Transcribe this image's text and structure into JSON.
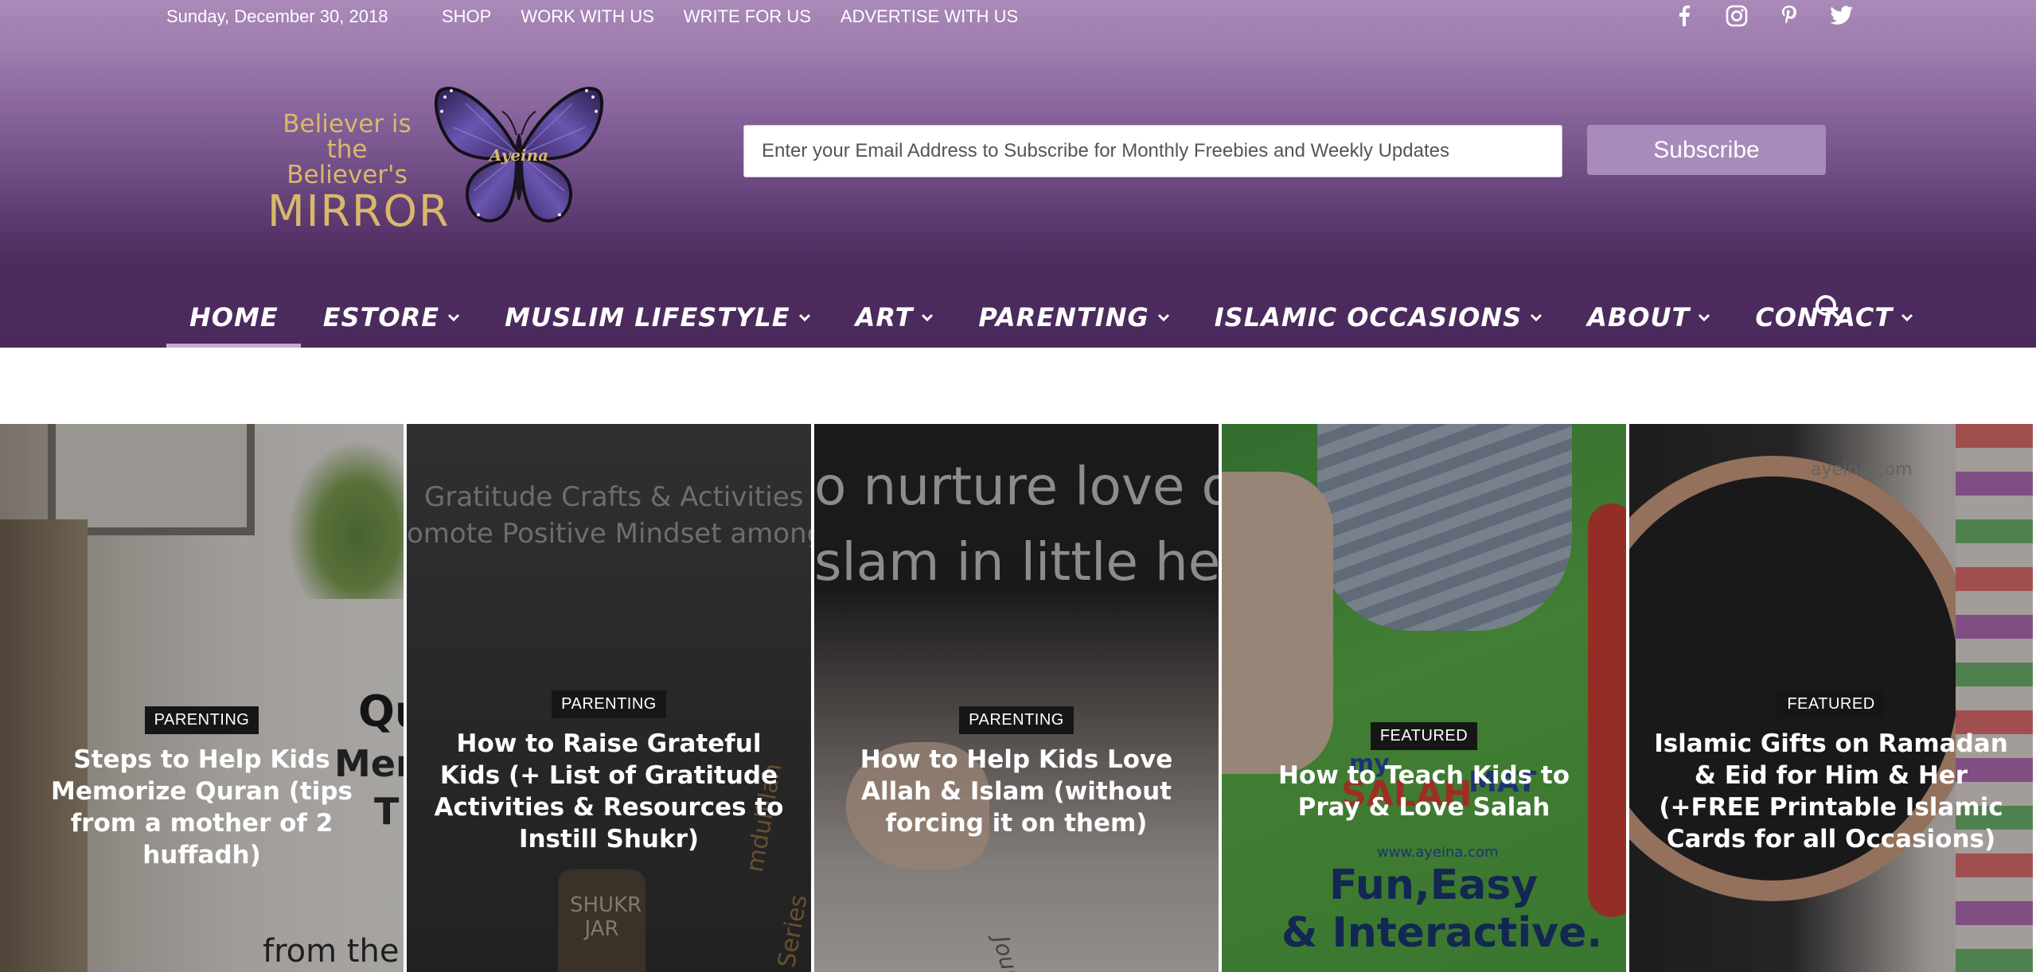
{
  "topbar": {
    "date": "Sunday, December 30, 2018",
    "links": [
      "SHOP",
      "WORK WITH US",
      "WRITE FOR US",
      "ADVERTISE WITH US"
    ]
  },
  "social_icons": [
    "facebook-icon",
    "instagram-icon",
    "pinterest-icon",
    "twitter-icon"
  ],
  "logo": {
    "line1": "Believer is",
    "line2": "the Believer's",
    "line3": "MIRROR",
    "butterfly_text": "Ayeina"
  },
  "subscribe": {
    "placeholder": "Enter your Email Address to Subscribe for Monthly Freebies and Weekly Updates",
    "button_label": "Subscribe"
  },
  "nav": {
    "items": [
      {
        "label": "HOME",
        "active": true,
        "dropdown": false
      },
      {
        "label": "ESTORE",
        "active": false,
        "dropdown": true
      },
      {
        "label": "MUSLIM LIFESTYLE",
        "active": false,
        "dropdown": true
      },
      {
        "label": "ART",
        "active": false,
        "dropdown": true
      },
      {
        "label": "PARENTING",
        "active": false,
        "dropdown": true
      },
      {
        "label": "ISLAMIC OCCASIONS",
        "active": false,
        "dropdown": true
      },
      {
        "label": "ABOUT",
        "active": false,
        "dropdown": true
      },
      {
        "label": "CONTACT",
        "active": false,
        "dropdown": true
      }
    ]
  },
  "posts": [
    {
      "category": "PARENTING",
      "title": "Steps to Help Kids Memorize Quran (tips from a mother of 2 huffadh)",
      "image_text": [
        "Qu",
        "Memo",
        "T",
        "from the"
      ]
    },
    {
      "category": "PARENTING",
      "title": "How to Raise Grateful Kids (+ List of Gratitude Activities & Resources to Instill Shukr)",
      "image_text": [
        "Gratitude Crafts & Activities",
        "omote Positive Mindset among",
        "SHUKR JAR",
        "mdulillah",
        "Series"
      ]
    },
    {
      "category": "PARENTING",
      "title": "How to Help Kids Love Allah & Islam (without forcing it on them)",
      "image_text": [
        "o nurture love o",
        "slam in little hea",
        "Journal"
      ]
    },
    {
      "category": "FEATURED",
      "title": "How to Teach Kids to Pray & Love Salah",
      "image_text": [
        "my",
        "SALAH",
        "MAT",
        "www.ayeina.com",
        "Fun,Easy",
        "& Interactive."
      ]
    },
    {
      "category": "FEATURED",
      "title": "Islamic Gifts on Ramadan & Eid for Him & Her (+FREE Printable Islamic Cards for all Occasions)",
      "image_text": [
        "ayeina.com"
      ]
    }
  ],
  "colors": {
    "header_top": "#a98ab8",
    "header_bottom": "#4a2a5c",
    "subscribe_button": "#a78bbb",
    "logo_gold": "#d8b96a",
    "active_underline": "#c5a8d6",
    "badge_bg": "#161616"
  }
}
